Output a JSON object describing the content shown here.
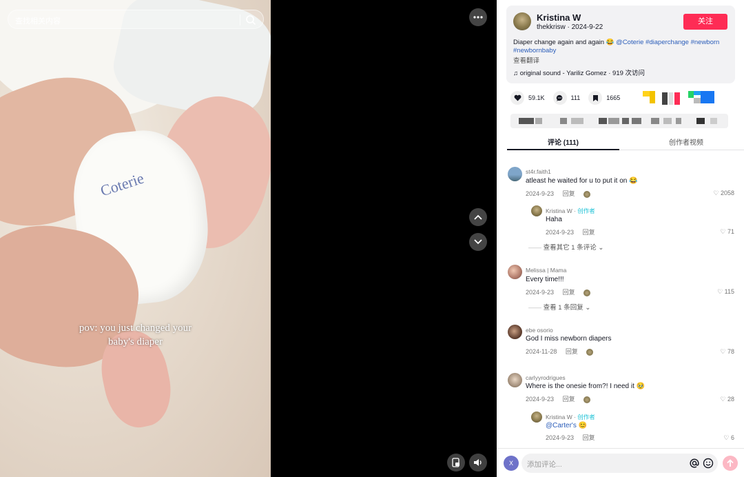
{
  "video": {
    "search_placeholder": "查找相关内容",
    "caption_line1": "pov: you just changed your",
    "caption_line2": "baby's diaper",
    "brand_on_diaper": "Coterie"
  },
  "author": {
    "name": "Kristina W",
    "handle": "thekkrisw",
    "date": "2024-9-22",
    "follow_label": "关注",
    "description_text": "Diaper change again and again 😂 ",
    "tags": [
      "@Coterie",
      "#diaperchange",
      "#newborn",
      "#newbornbaby"
    ],
    "translate_label": "查看翻译",
    "sound": "original sound - Yariliz Gomez · 919 次访问"
  },
  "stats": {
    "likes": "59.1K",
    "comments": "111",
    "saves": "1665"
  },
  "tabs": {
    "comments": "评论 (111)",
    "creator_videos": "创作者视频"
  },
  "comments": [
    {
      "user": "st4r.faith1",
      "text": "atleast he waited for u to put it on 😂",
      "date": "2024-9-23",
      "reply": "回复",
      "likes": "2058",
      "replies": [
        {
          "user": "Kristina W",
          "creator": "创作者",
          "text": "Haha",
          "date": "2024-9-23",
          "reply": "回复",
          "likes": "71"
        }
      ],
      "more": "查看其它 1 条评论"
    },
    {
      "user": "Melissa | Mama",
      "text": "Every time!!!",
      "date": "2024-9-23",
      "reply": "回复",
      "likes": "115",
      "more": "查看 1 条回复"
    },
    {
      "user": "ebe osorio",
      "text": "God I miss newborn diapers",
      "date": "2024-11-28",
      "reply": "回复",
      "likes": "78"
    },
    {
      "user": "carlyyrodrigues",
      "text": "Where is the onesie from?! I need it 🥹",
      "date": "2024-9-23",
      "reply": "回复",
      "likes": "28",
      "replies": [
        {
          "user": "Kristina W",
          "creator": "创作者",
          "text": "@Carter's 😊",
          "date": "2024-9-23",
          "reply": "回复",
          "likes": "6"
        }
      ]
    }
  ],
  "composer": {
    "placeholder": "添加评论...",
    "avatar_letter": "X"
  },
  "colors": {
    "accent": "#fe2c55",
    "tag": "#2b5db9",
    "creator_badge": "#1dc2d6"
  }
}
